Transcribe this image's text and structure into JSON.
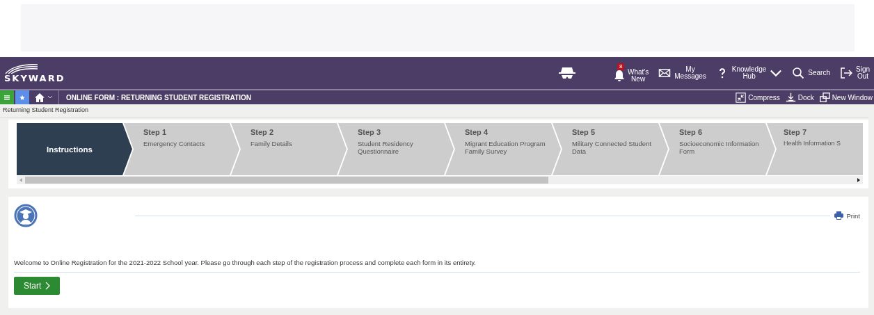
{
  "header": {
    "logo": "SKYWARD",
    "links": [
      {
        "kind": "bell",
        "lines": [
          "What's",
          "New"
        ],
        "badge": "8",
        "caret": false
      },
      {
        "kind": "mail",
        "lines": [
          "My",
          "Messages"
        ],
        "caret": false
      },
      {
        "kind": "help",
        "lines": [
          "Knowledge",
          "Hub"
        ],
        "caret": true
      },
      {
        "kind": "search",
        "lines": [
          "Search"
        ],
        "caret": false
      },
      {
        "kind": "signout",
        "lines": [
          "Sign",
          "Out"
        ],
        "caret": false
      }
    ]
  },
  "toolbar": {
    "title": "ONLINE FORM : RETURNING STUDENT REGISTRATION",
    "actions": [
      {
        "kind": "compress",
        "label": "Compress"
      },
      {
        "kind": "dock",
        "label": "Dock"
      },
      {
        "kind": "window",
        "label": "New Window"
      }
    ]
  },
  "breadcrumb": "Returning Student Registration",
  "steps": [
    {
      "title": "Instructions",
      "selected": true
    },
    {
      "step": "Step 1",
      "title": "Emergency Contacts",
      "selected": false
    },
    {
      "step": "Step 2",
      "title": "Family Details",
      "selected": false
    },
    {
      "step": "Step 3",
      "title": "Student Residency Questionnaire",
      "selected": false
    },
    {
      "step": "Step 4",
      "title": "Migrant Education Program Family Survey",
      "selected": false
    },
    {
      "step": "Step 5",
      "title": "Military Connected Student Data",
      "selected": false
    },
    {
      "step": "Step 6",
      "title": "Socioeconomic Information Form",
      "selected": false
    },
    {
      "step": "Step 7",
      "title": "Health Information S",
      "selected": false
    }
  ],
  "card": {
    "print": "Print",
    "message": "Welcome to Online Registration for the 2021-2022 School year. Please go through each step of the registration process and complete each form in its entirety.",
    "start": "Start"
  }
}
